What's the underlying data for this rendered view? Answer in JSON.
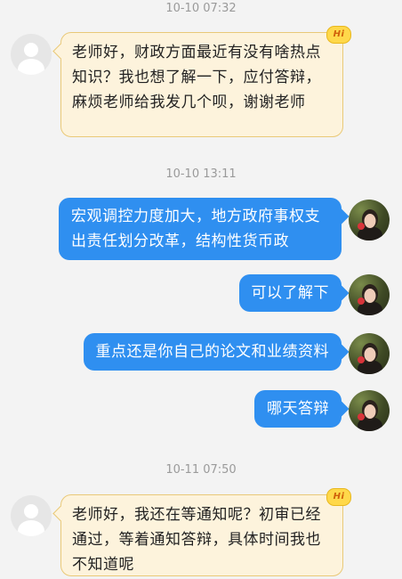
{
  "messages": [
    {
      "type": "timestamp",
      "text": "10-10 07:32"
    },
    {
      "type": "incoming",
      "text": "老师好，财政方面最近有没有啥热点知识？我也想了解一下，应付答辩，麻烦老师给我发几个呗，谢谢老师",
      "badge": "Hi"
    },
    {
      "type": "timestamp",
      "text": "10-10 13:11"
    },
    {
      "type": "outgoing",
      "text": "宏观调控力度加大，地方政府事权支出责任划分改革，结构性货币政"
    },
    {
      "type": "outgoing",
      "text": "可以了解下"
    },
    {
      "type": "outgoing",
      "text": "重点还是你自己的论文和业绩资料"
    },
    {
      "type": "outgoing",
      "text": "哪天答辩"
    },
    {
      "type": "timestamp",
      "text": "10-11 07:50"
    },
    {
      "type": "incoming",
      "text": "老师好，我还在等通知呢？初审已经通过，等着通知答辩，具体时间我也不知道呢",
      "badge": "Hi"
    }
  ],
  "colors": {
    "outgoing_bubble": "#2f8ff0",
    "incoming_bubble": "#fdf3dc",
    "incoming_border": "#e9c978",
    "background": "#f3f3f3"
  },
  "icons": {
    "incoming_avatar": "default-user-avatar-icon",
    "outgoing_avatar": "user-photo-avatar",
    "badge": "hi-badge-icon"
  }
}
